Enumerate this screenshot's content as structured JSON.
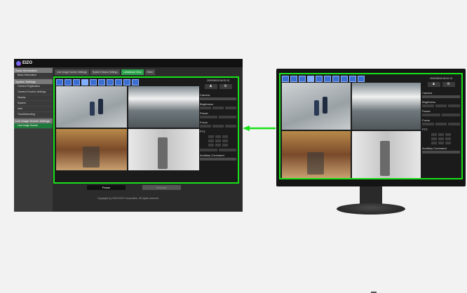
{
  "app": {
    "logo_text": "EIZO",
    "sidebar": [
      {
        "type": "head",
        "label": "Basic Information"
      },
      {
        "type": "item",
        "label": "Basic Information"
      },
      {
        "type": "head",
        "label": "System Settings"
      },
      {
        "type": "item",
        "label": "Camera Registration"
      },
      {
        "type": "item",
        "label": "Camera Function Settings"
      },
      {
        "type": "item",
        "label": "Display"
      },
      {
        "type": "item",
        "label": "System"
      },
      {
        "type": "item",
        "label": "User"
      },
      {
        "type": "item",
        "label": "Troubleshooting"
      },
      {
        "type": "head",
        "label": "Live Image Screen Settings"
      },
      {
        "type": "item",
        "label": "Live Image Screen",
        "active": true
      }
    ],
    "tabs": [
      {
        "label": "Live Image Screen Settings",
        "active": false
      },
      {
        "label": "System Status Settings",
        "active": false
      },
      {
        "label": "Livestream View",
        "active": true
      },
      {
        "label": "Other",
        "active": false
      }
    ],
    "control_panel": {
      "datetime": "2020/05/15 06:20:13",
      "camera_label": "Camera",
      "brightness_label": "Brightness",
      "preset_label": "Preset",
      "focus_label": "Focus",
      "ptz_label": "PTZ",
      "aux_label": "Auxiliary Command"
    },
    "buttons": {
      "pause": "Pause",
      "second": "Release"
    },
    "copyright": "Copyright (c) 2020 EIZO Corporation. All rights reserved."
  },
  "monitor": {
    "datetime": "2020/05/15 06:20:13",
    "camera_label": "Camera",
    "brightness_label": "Brightness",
    "preset_label": "Preset",
    "focus_label": "Focus",
    "ptz_label": "PTZ",
    "aux_label": "Auxiliary Command"
  },
  "colors": {
    "highlight": "#19e019",
    "active_tab": "#2aa24a",
    "active_sidebar": "#1e7a3a"
  }
}
